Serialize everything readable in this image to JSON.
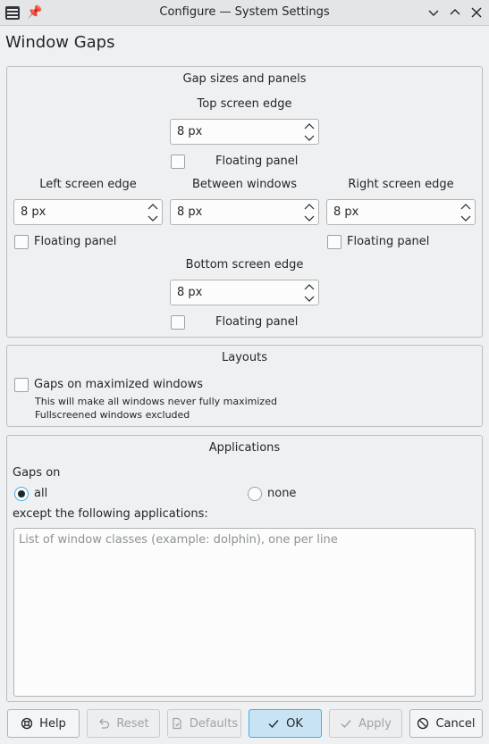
{
  "window": {
    "title": "Configure — System Settings",
    "app_icon": "settings-sliders-icon",
    "pin_icon": "pin-icon"
  },
  "page": {
    "title": "Window Gaps"
  },
  "gaps_group": {
    "title": "Gap sizes and panels",
    "top": {
      "label": "Top screen edge",
      "value": "8 px",
      "floating_label": "Floating panel",
      "floating_checked": false
    },
    "left": {
      "label": "Left screen edge",
      "value": "8 px",
      "floating_label": "Floating panel",
      "floating_checked": false
    },
    "between": {
      "label": "Between windows",
      "value": "8 px"
    },
    "right": {
      "label": "Right screen edge",
      "value": "8 px",
      "floating_label": "Floating panel",
      "floating_checked": false
    },
    "bottom": {
      "label": "Bottom screen edge",
      "value": "8 px",
      "floating_label": "Floating panel",
      "floating_checked": false
    }
  },
  "layouts_group": {
    "title": "Layouts",
    "maximized_label": "Gaps on maximized windows",
    "maximized_checked": false,
    "note1": "This will make all windows never fully maximized",
    "note2": "Fullscreened windows excluded"
  },
  "applications_group": {
    "title": "Applications",
    "gaps_on_label": "Gaps on",
    "options": [
      {
        "label": "all",
        "selected": true
      },
      {
        "label": "none",
        "selected": false
      }
    ],
    "except_label": "except the following applications:",
    "list_placeholder": "List of window classes (example: dolphin), one per line"
  },
  "buttons": {
    "help": "Help",
    "reset": "Reset",
    "defaults": "Defaults",
    "ok": "OK",
    "apply": "Apply",
    "cancel": "Cancel"
  },
  "colors": {
    "accent": "#3daee9",
    "background": "#eff0f1"
  }
}
